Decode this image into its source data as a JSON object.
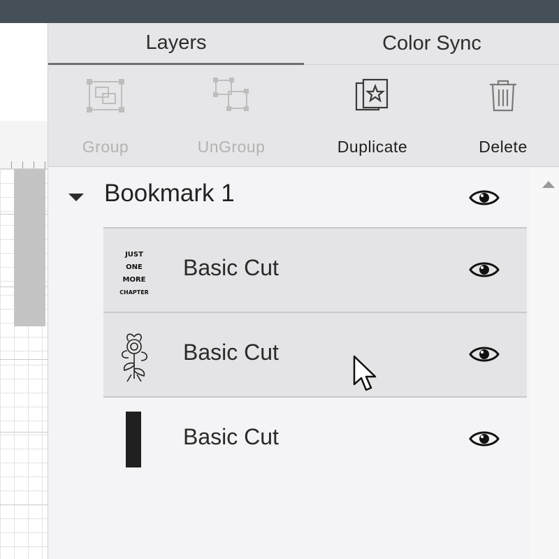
{
  "tabs": [
    {
      "label": "Layers"
    },
    {
      "label": "Color Sync"
    }
  ],
  "toolbar": {
    "group_label": "Group",
    "ungroup_label": "UnGroup",
    "duplicate_label": "Duplicate",
    "delete_label": "Delete"
  },
  "layers": {
    "group_name": "Bookmark 1",
    "items": [
      {
        "name": "Basic Cut",
        "thumbnail": "text-design-thumbnail",
        "thumb_text": [
          "JUST",
          "ONE",
          "MORE",
          "CHAPTER"
        ]
      },
      {
        "name": "Basic Cut",
        "thumbnail": "floral-design-thumbnail"
      },
      {
        "name": "Basic Cut",
        "thumbnail": "black-rectangle-thumbnail"
      }
    ]
  },
  "icons": {
    "group": "group-icon",
    "ungroup": "ungroup-icon",
    "duplicate": "duplicate-icon",
    "delete": "trash-icon",
    "visibility": "eye-icon",
    "collapse": "caret-down-icon",
    "scroll_up": "scroll-up-arrow-icon"
  },
  "colors": {
    "top_bar": "#454f57",
    "panel_bg": "#eeeef0",
    "selected_row": "#e4e4e6",
    "disabled_text": "#b3b3b3"
  }
}
